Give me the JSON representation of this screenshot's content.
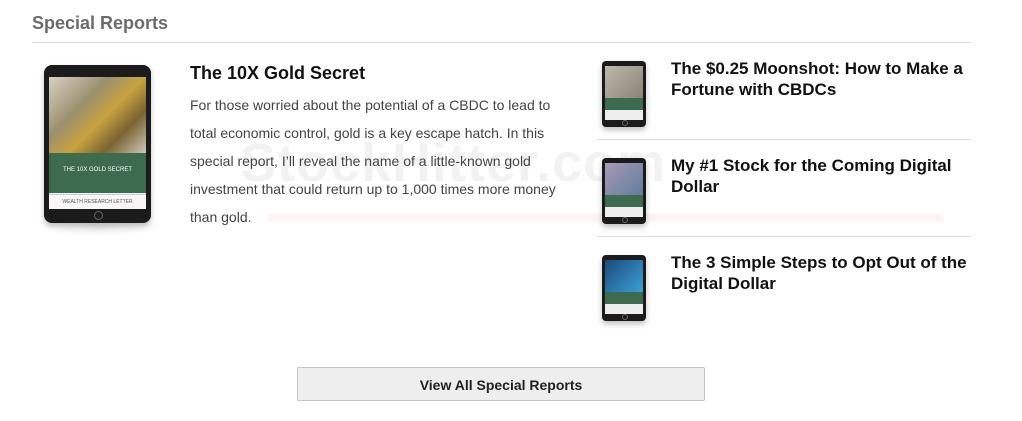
{
  "section": {
    "title": "Special Reports"
  },
  "featured": {
    "title": "The 10X Gold Secret",
    "description": "For those worried about the potential of a CBDC to lead to total economic control, gold is a key escape hatch. In this special report, I’ll reveal the name of a little-known gold investment that could return up to 1,000 times more money than gold.",
    "cover_title": "THE 10X GOLD SECRET",
    "cover_footer": "WEALTH RESEARCH LETTER"
  },
  "side_reports": [
    {
      "title": "The $0.25 Moonshot: How to Make a Fortune with CBDCs",
      "cover_colors": [
        "#bdb9ad",
        "#8a8476"
      ]
    },
    {
      "title": "My #1 Stock for the Coming Digital Dollar",
      "cover_colors": [
        "#a99ab6",
        "#5e7d9c"
      ]
    },
    {
      "title": "The 3 Simple Steps to Opt Out of the Digital Dollar",
      "cover_colors": [
        "#1a4a7a",
        "#3aa0d8"
      ]
    }
  ],
  "watermark": "StockHitter.com",
  "view_all_label": "View All Special Reports"
}
